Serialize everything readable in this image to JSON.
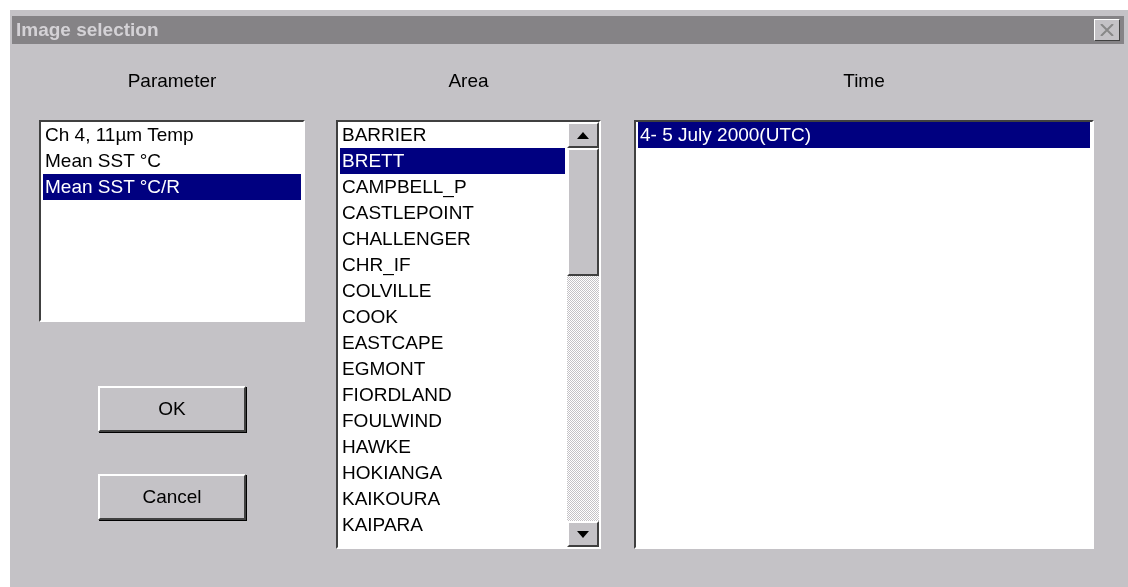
{
  "window": {
    "title": "Image selection"
  },
  "parameter": {
    "label": "Parameter",
    "items": [
      {
        "text": "Ch 4, 11µm  Temp",
        "selected": false
      },
      {
        "text": "Mean SST °C",
        "selected": false
      },
      {
        "text": "Mean SST °C/R",
        "selected": true
      }
    ]
  },
  "area": {
    "label": "Area",
    "items": [
      {
        "text": "BARRIER",
        "selected": false
      },
      {
        "text": "BRETT",
        "selected": true
      },
      {
        "text": "CAMPBELL_P",
        "selected": false
      },
      {
        "text": "CASTLEPOINT",
        "selected": false
      },
      {
        "text": "CHALLENGER",
        "selected": false
      },
      {
        "text": "CHR_IF",
        "selected": false
      },
      {
        "text": "COLVILLE",
        "selected": false
      },
      {
        "text": "COOK",
        "selected": false
      },
      {
        "text": "EASTCAPE",
        "selected": false
      },
      {
        "text": "EGMONT",
        "selected": false
      },
      {
        "text": "FIORDLAND",
        "selected": false
      },
      {
        "text": "FOULWIND",
        "selected": false
      },
      {
        "text": "HAWKE",
        "selected": false
      },
      {
        "text": "HOKIANGA",
        "selected": false
      },
      {
        "text": "KAIKOURA",
        "selected": false
      },
      {
        "text": "KAIPARA",
        "selected": false
      }
    ]
  },
  "time": {
    "label": "Time",
    "items": [
      {
        "text": "4- 5 July 2000(UTC)",
        "selected": true
      }
    ]
  },
  "buttons": [
    "OK",
    "Cancel"
  ]
}
